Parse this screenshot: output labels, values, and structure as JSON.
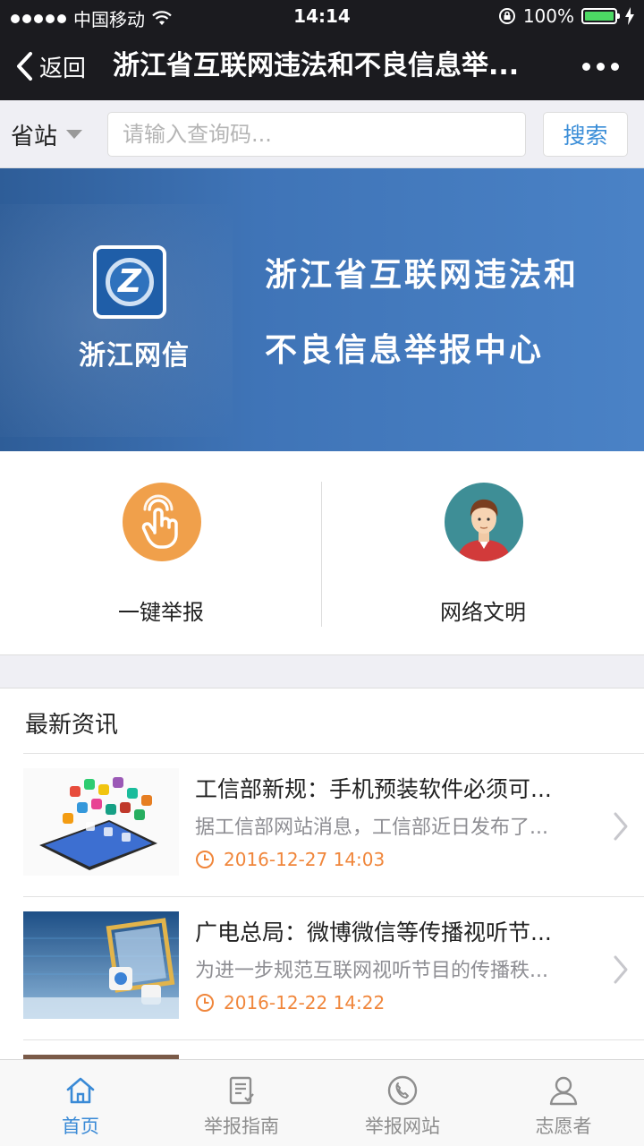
{
  "status_bar": {
    "carrier": "中国移动",
    "time": "14:14",
    "battery": "100%",
    "icons": [
      "signal-dots-icon",
      "wifi-icon",
      "rotation-lock-icon",
      "battery-icon",
      "charging-bolt-icon"
    ]
  },
  "nav": {
    "back_label": "返回",
    "title": "浙江省互联网违法和不良信息举...",
    "more_icon": "more-dots-icon"
  },
  "search": {
    "province_label": "省站",
    "placeholder": "请输入查询码...",
    "button_label": "搜索"
  },
  "banner": {
    "logo_text": "浙江网信",
    "line1": "浙江省互联网违法和",
    "line2": "不良信息举报中心"
  },
  "quick_actions": [
    {
      "label": "一键举报",
      "icon": "tap-hand-icon",
      "color": "#f0a04b"
    },
    {
      "label": "网络文明",
      "icon": "person-avatar-icon",
      "color": "#3e8e96"
    }
  ],
  "news": {
    "heading": "最新资讯",
    "items": [
      {
        "title": "工信部新规：手机预装软件必须可...",
        "summary": "据工信部网站消息，工信部近日发布了...",
        "time": "2016-12-27 14:03"
      },
      {
        "title": "广电总局：微博微信等传播视听节...",
        "summary": "为进一步规范互联网视听节目的传播秩...",
        "time": "2016-12-22 14:22"
      }
    ]
  },
  "tabs": [
    {
      "label": "首页",
      "icon": "home-icon",
      "active": true
    },
    {
      "label": "举报指南",
      "icon": "guide-document-icon",
      "active": false
    },
    {
      "label": "举报网站",
      "icon": "phone-call-icon",
      "active": false
    },
    {
      "label": "志愿者",
      "icon": "user-icon",
      "active": false
    }
  ],
  "colors": {
    "accent": "#3a8ad6",
    "time_orange": "#f0863b",
    "banner_blue": "#4a82c6",
    "dark_bar": "#1b1b1f"
  }
}
